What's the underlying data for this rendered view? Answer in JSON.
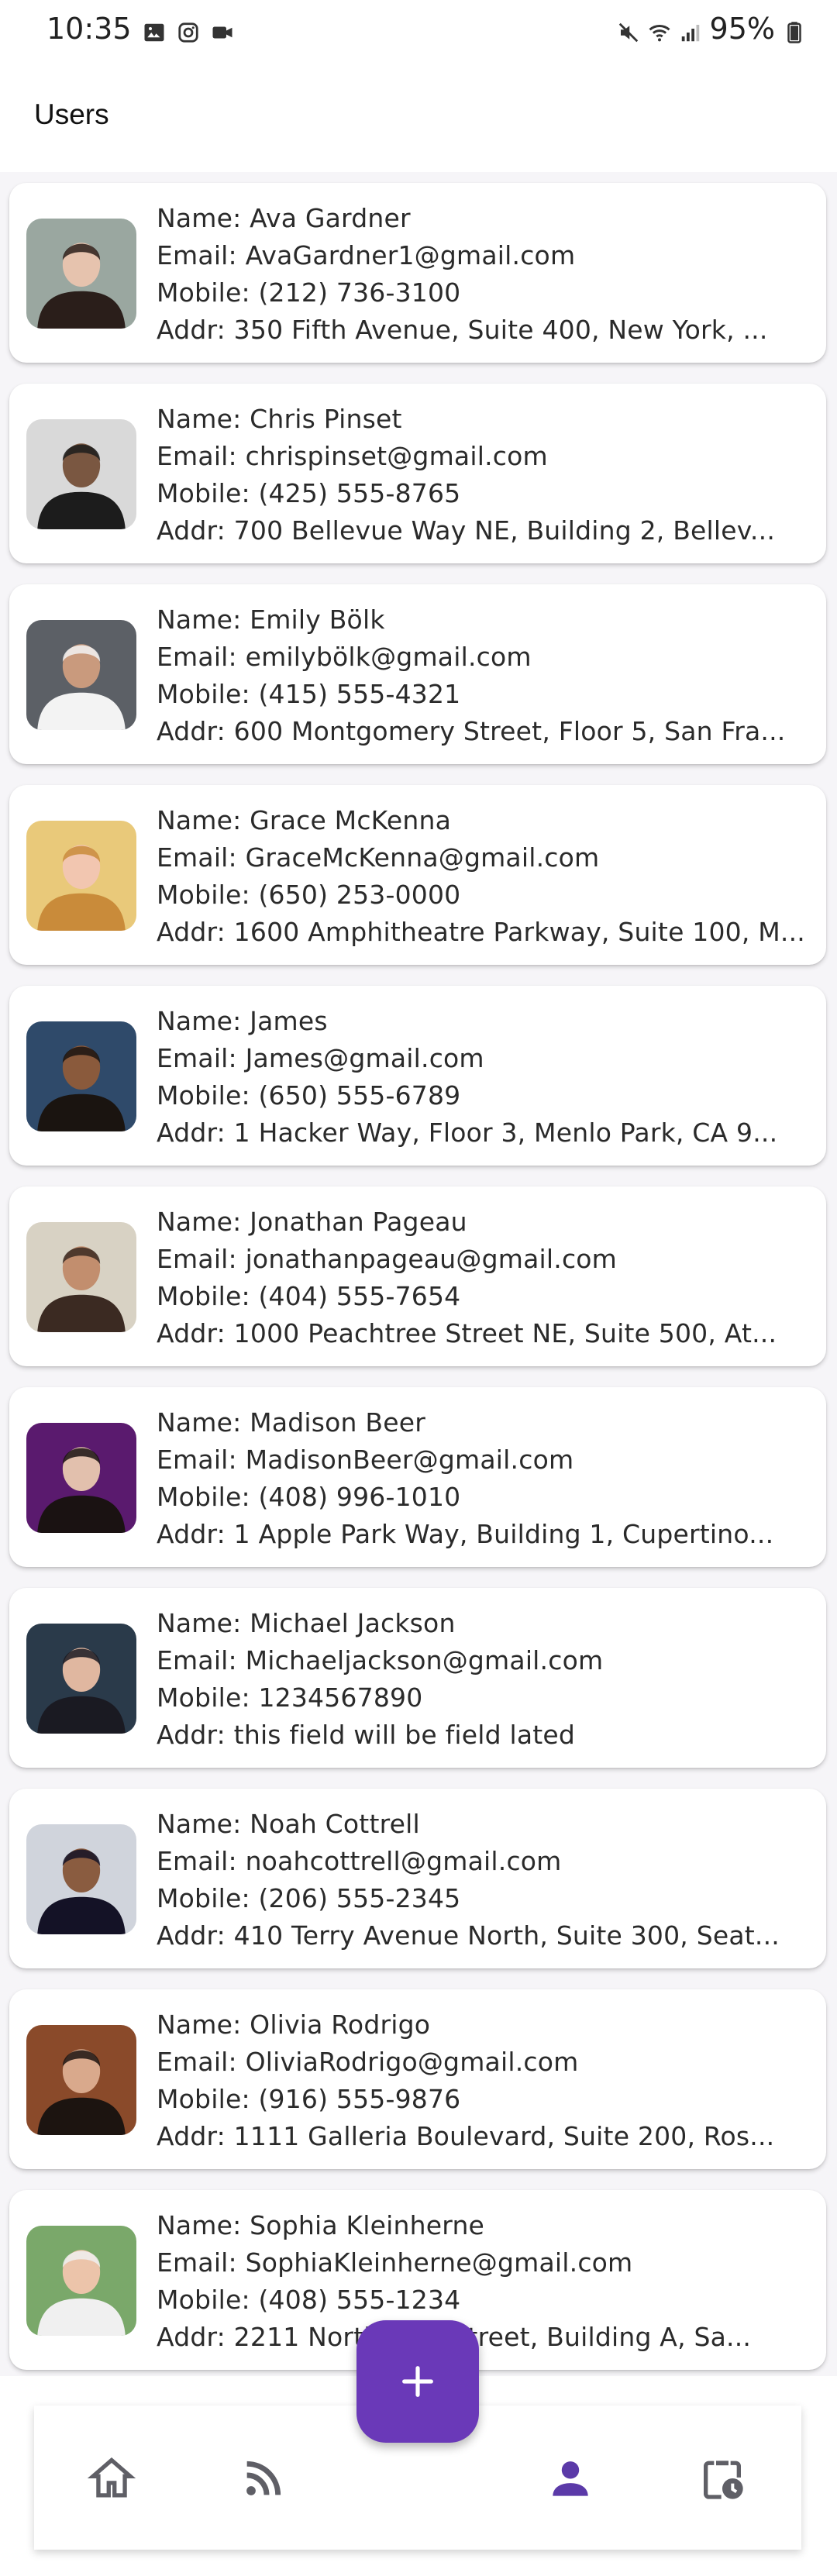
{
  "status_bar": {
    "time": "10:35",
    "battery": "95%"
  },
  "app_bar": {
    "title": "Users"
  },
  "users": [
    {
      "name": "Name: Ava Gardner",
      "email": "Email: AvaGardner1@gmail.com",
      "mobile": "Mobile: (212) 736-3100",
      "addr": "Addr: 350 Fifth Avenue, Suite 400, New York, ..."
    },
    {
      "name": "Name: Chris Pinset",
      "email": "Email: chrispinset@gmail.com",
      "mobile": "Mobile: (425) 555-8765",
      "addr": "Addr: 700 Bellevue Way NE, Building 2, Bellev..."
    },
    {
      "name": "Name: Emily Bölk",
      "email": "Email: emilybölk@gmail.com",
      "mobile": "Mobile: (415) 555-4321",
      "addr": "Addr: 600 Montgomery Street, Floor 5, San Fra..."
    },
    {
      "name": "Name: Grace McKenna",
      "email": "Email: GraceMcKenna@gmail.com",
      "mobile": "Mobile: (650) 253-0000",
      "addr": "Addr: 1600 Amphitheatre Parkway, Suite 100, M..."
    },
    {
      "name": "Name: James",
      "email": "Email: James@gmail.com",
      "mobile": "Mobile: (650) 555-6789",
      "addr": "Addr: 1 Hacker Way, Floor 3, Menlo Park, CA 9..."
    },
    {
      "name": "Name: Jonathan Pageau",
      "email": "Email: jonathanpageau@gmail.com",
      "mobile": "Mobile: (404) 555-7654",
      "addr": "Addr: 1000 Peachtree Street NE, Suite 500, At..."
    },
    {
      "name": "Name: Madison Beer",
      "email": "Email: MadisonBeer@gmail.com",
      "mobile": "Mobile: (408) 996-1010",
      "addr": "Addr: 1 Apple Park Way, Building 1, Cupertino..."
    },
    {
      "name": "Name: Michael Jackson",
      "email": "Email: Michaeljackson@gmail.com",
      "mobile": "Mobile: 1234567890",
      "addr": "Addr: this field will be field lated"
    },
    {
      "name": "Name: Noah Cottrell",
      "email": "Email: noahcottrell@gmail.com",
      "mobile": "Mobile: (206) 555-2345",
      "addr": "Addr: 410 Terry Avenue North, Suite 300, Seat..."
    },
    {
      "name": "Name: Olivia Rodrigo",
      "email": "Email: OliviaRodrigo@gmail.com",
      "mobile": "Mobile: (916) 555-9876",
      "addr": "Addr: 1111 Galleria Boulevard, Suite 200, Ros..."
    },
    {
      "name": "Name: Sophia Kleinherne",
      "email": "Email: SophiaKleinherne@gmail.com",
      "mobile": "Mobile: (408) 555-1234",
      "addr": "Addr: 2211 North First Street, Building A, Sa..."
    }
  ],
  "avatar_colors": [
    [
      "#9aa7a0",
      "#2a1e1a",
      "#e6c3ae"
    ],
    [
      "#d9d9d9",
      "#1c1c1c",
      "#7a5741"
    ],
    [
      "#5c6066",
      "#f3f3f3",
      "#c99a7d"
    ],
    [
      "#e9c97a",
      "#c98b3a",
      "#f2c6b0"
    ],
    [
      "#2f4a6a",
      "#1a1410",
      "#8a5a3c"
    ],
    [
      "#d8d2c4",
      "#3b2a22",
      "#c28e6e"
    ],
    [
      "#5a1a6e",
      "#1a1212",
      "#e2c0ad"
    ],
    [
      "#2a3a4a",
      "#1a1a22",
      "#e0b7a0"
    ],
    [
      "#d0d4dc",
      "#141226",
      "#8a5c40"
    ],
    [
      "#8a4a2a",
      "#1c1410",
      "#d9a98c"
    ],
    [
      "#7aa86a",
      "#f0f0f0",
      "#ecc4aa"
    ]
  ],
  "nav": {
    "items": [
      "home-icon",
      "rss-feed-icon",
      "person-icon",
      "clipboard-clock-icon"
    ],
    "active": "person-icon",
    "active_color": "#5b3aa8",
    "inactive_color": "#5f5f66"
  },
  "fab": {
    "icon": "plus-icon",
    "color": "#6a39b8"
  }
}
